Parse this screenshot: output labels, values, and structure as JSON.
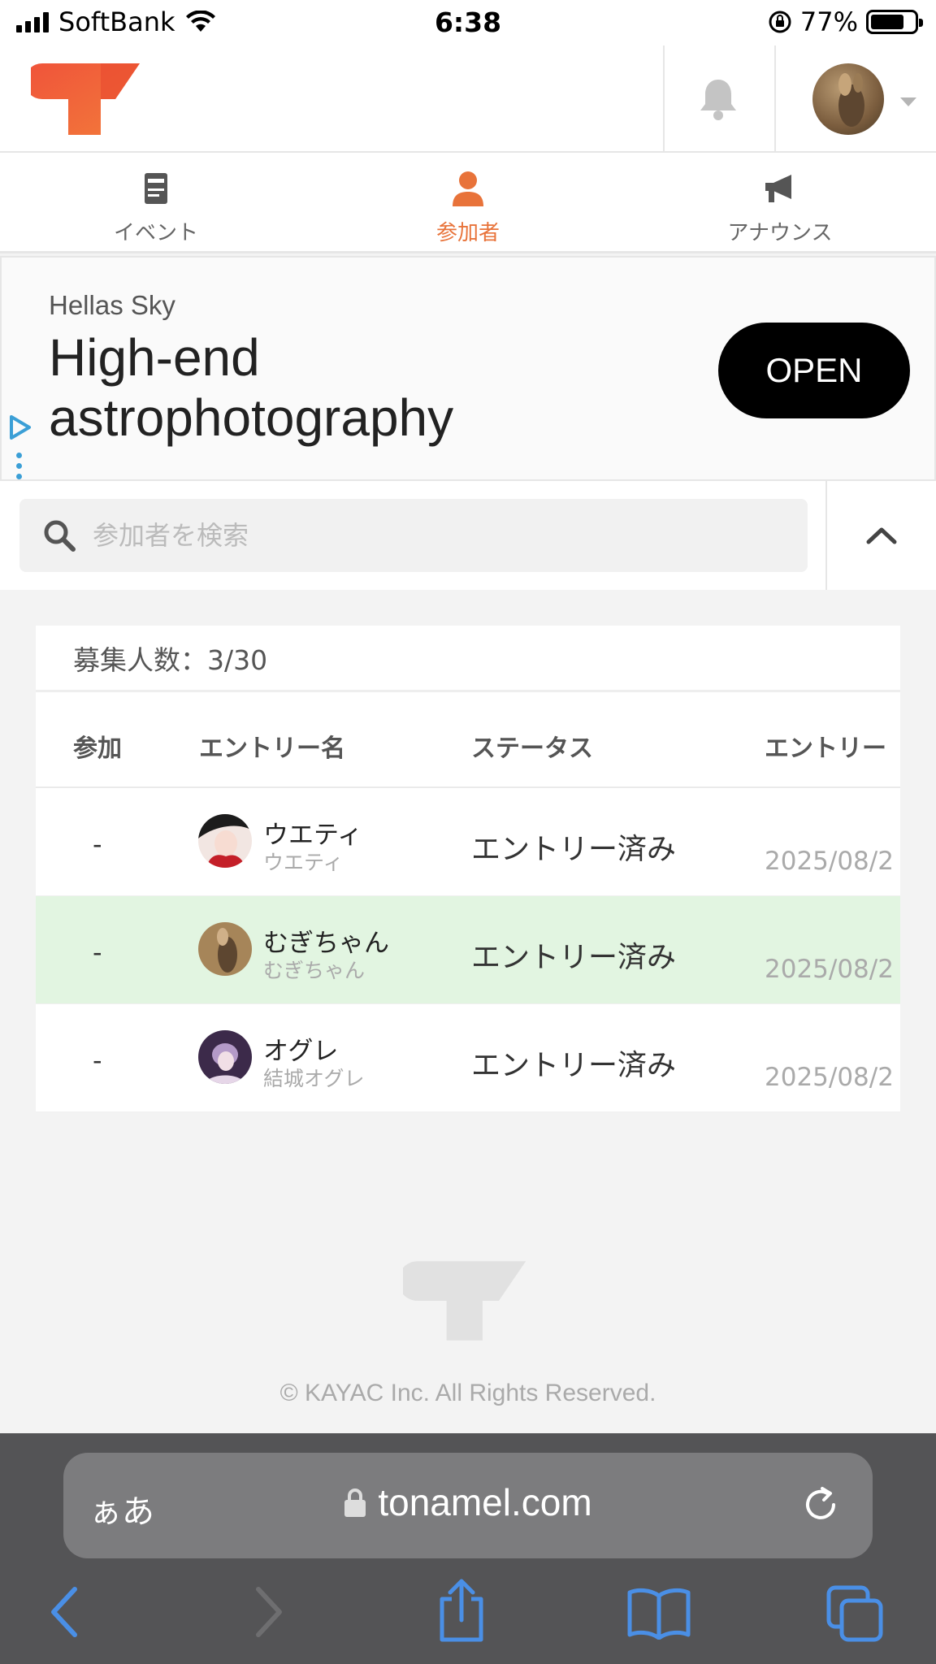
{
  "status_bar": {
    "carrier": "SoftBank",
    "time": "6:38",
    "battery": "77%"
  },
  "tabs": [
    {
      "label": "イベント",
      "icon": "document-icon",
      "active": false
    },
    {
      "label": "参加者",
      "icon": "person-icon",
      "active": true
    },
    {
      "label": "アナウンス",
      "icon": "megaphone-icon",
      "active": false
    }
  ],
  "ad": {
    "sponsor": "Hellas Sky",
    "title": "High-end astrophotography",
    "cta": "OPEN"
  },
  "search": {
    "placeholder": "参加者を検索"
  },
  "participants": {
    "recruit_count": "募集人数：3/30",
    "columns": [
      "参加",
      "エントリー名",
      "ステータス",
      "エントリー"
    ],
    "rows": [
      {
        "join": "-",
        "name": "ウエティ",
        "sub": "ウエティ",
        "status": "エントリー済み",
        "date": "2025/08/2"
      },
      {
        "join": "-",
        "name": "むぎちゃん",
        "sub": "むぎちゃん",
        "status": "エントリー済み",
        "date": "2025/08/2"
      },
      {
        "join": "-",
        "name": "オグレ",
        "sub": "結城オグレ",
        "status": "エントリー済み",
        "date": "2025/08/2"
      }
    ]
  },
  "footer": {
    "copyright": "© KAYAC Inc. All Rights Reserved."
  },
  "browser": {
    "aa": "ぁあ",
    "url": "tonamel.com"
  },
  "colors": {
    "accent": "#e8733a",
    "highlight_row": "#e2f5e1",
    "browser_bar": "#545456",
    "browser_icon": "#4a8fe6"
  }
}
